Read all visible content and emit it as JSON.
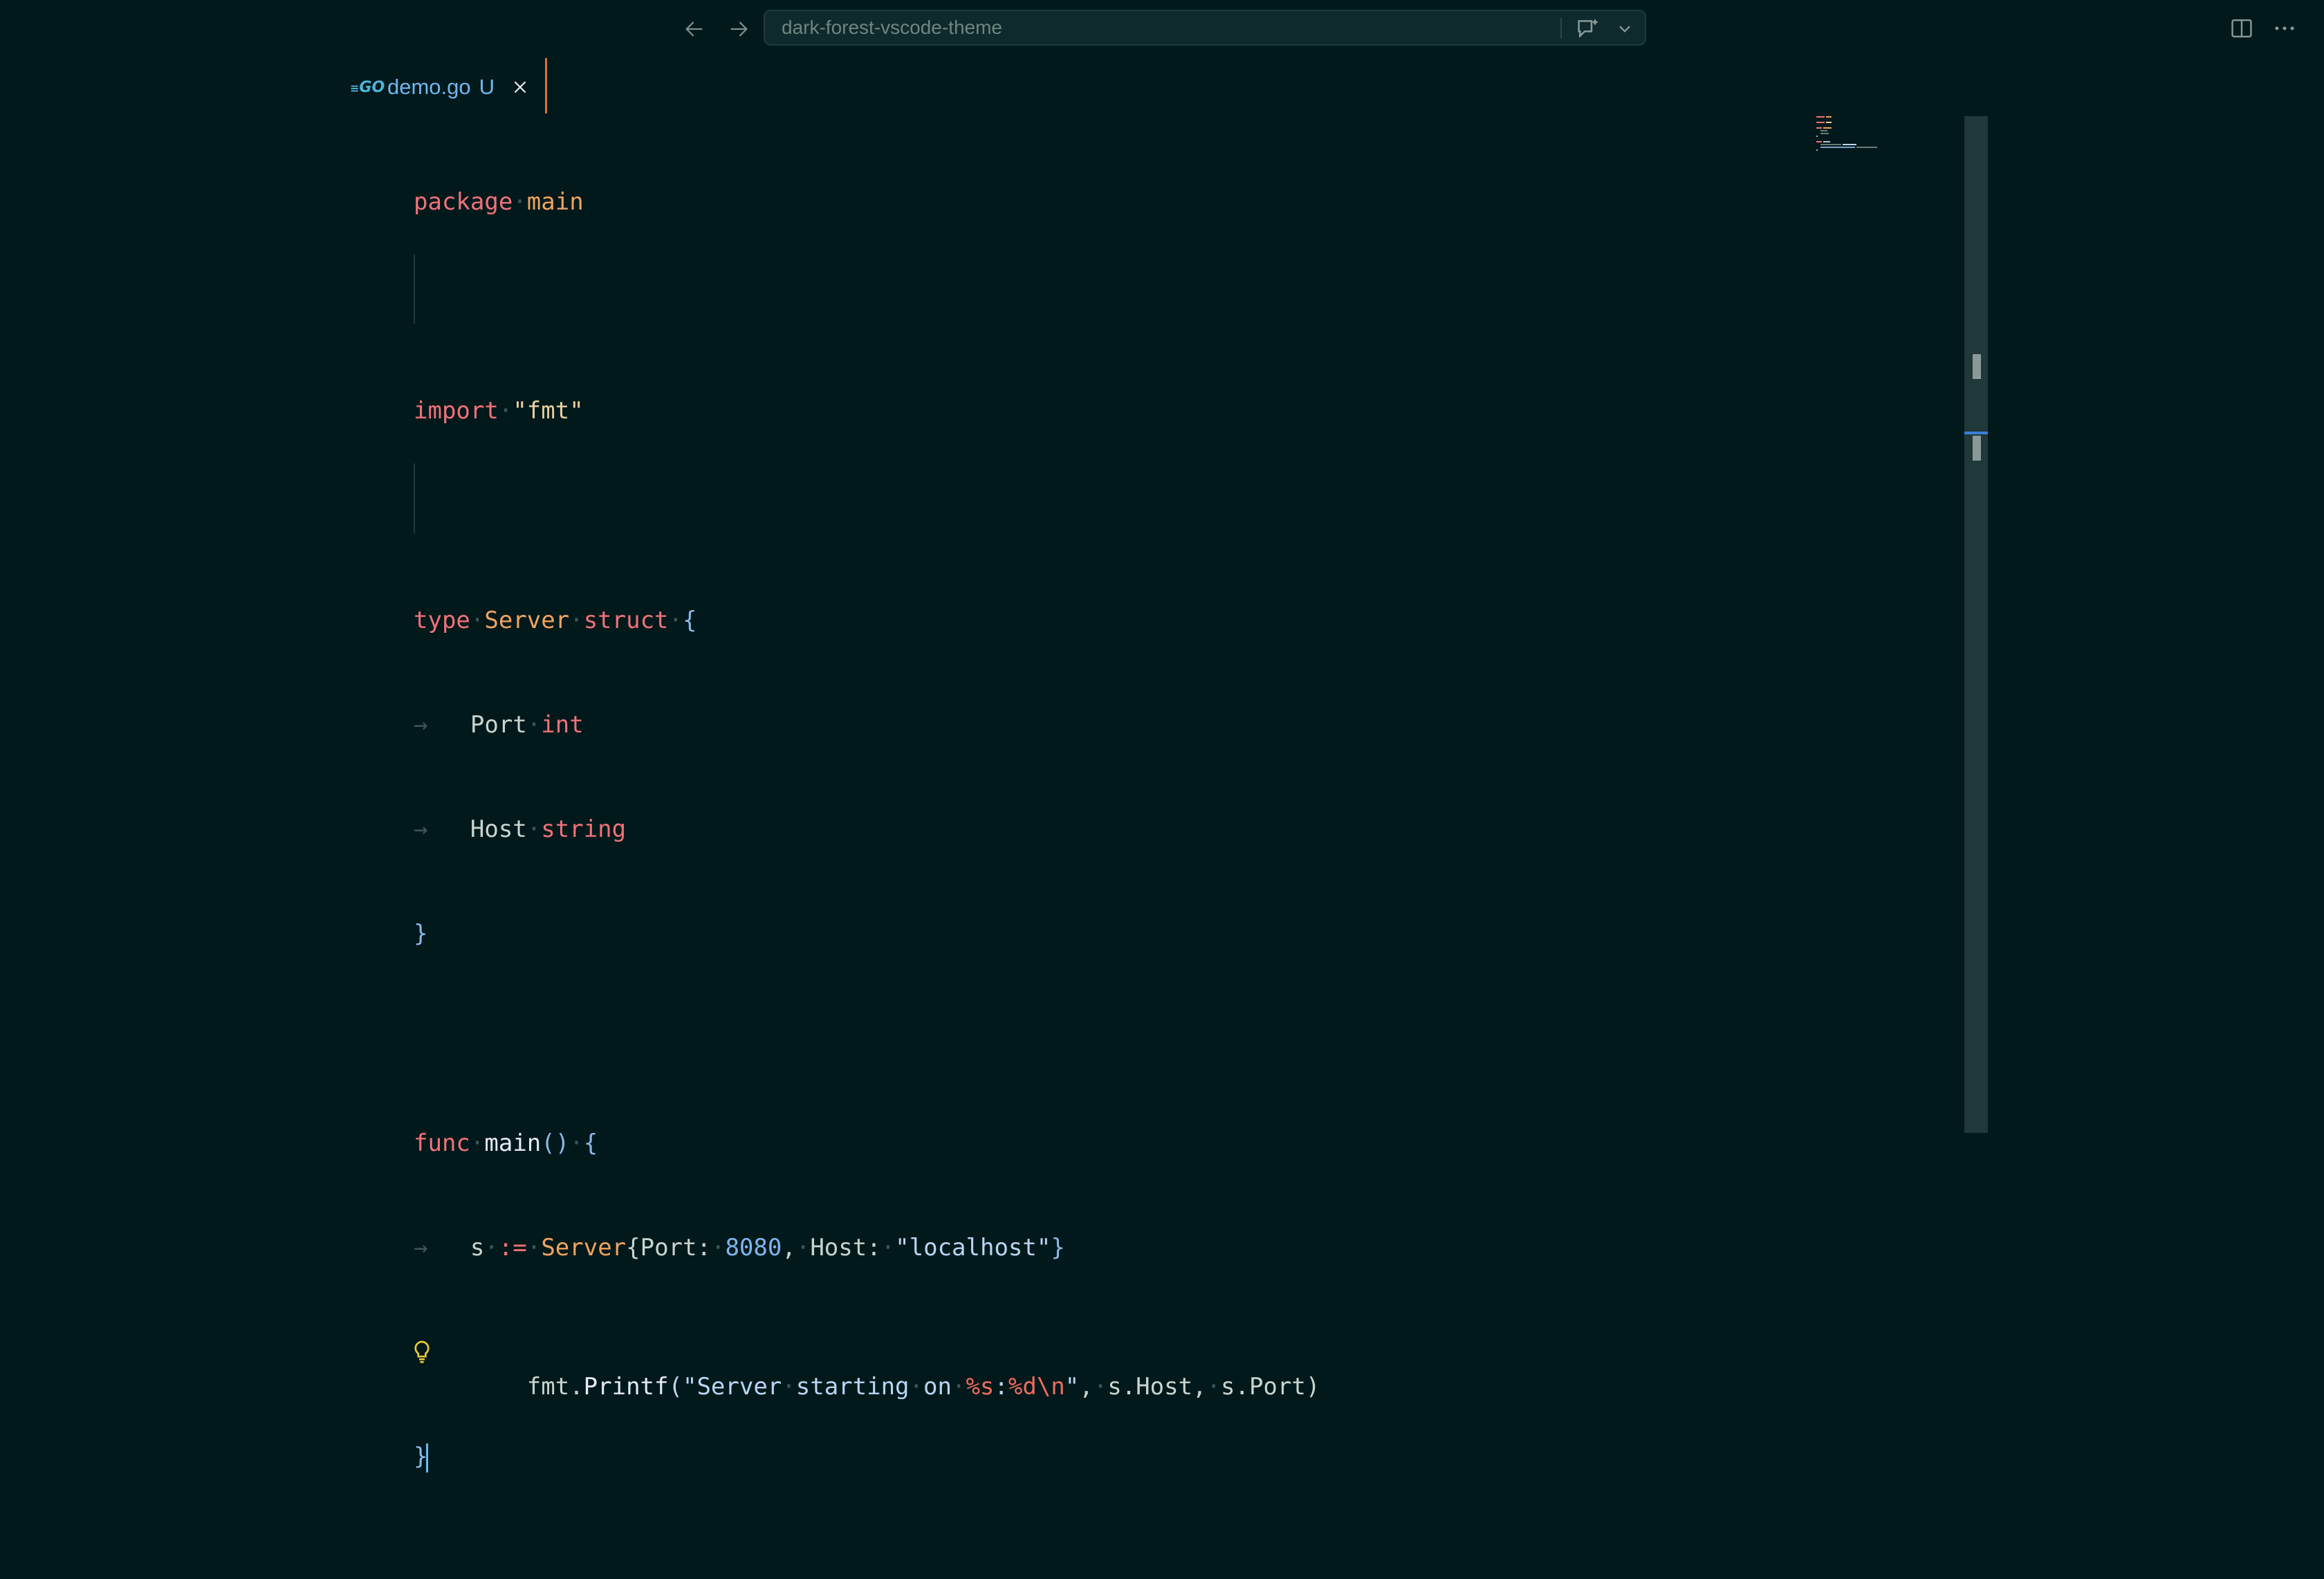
{
  "titlebar": {
    "search_text": "dark-forest-vscode-theme",
    "icons": [
      "arrow-left-icon",
      "arrow-right-icon",
      "chat-sparkle-icon",
      "chevron-down-icon",
      "split-editor-icon",
      "more-actions-icon"
    ]
  },
  "tab": {
    "icon_text": "GO",
    "filename": "demo.go",
    "status": "U"
  },
  "editor": {
    "language": "go",
    "code": {
      "l1": [
        "package",
        "·",
        "main"
      ],
      "l3": [
        "import",
        "·",
        "\"fmt\""
      ],
      "l5": [
        "type",
        "·",
        "Server",
        "·",
        "struct",
        "·",
        "{"
      ],
      "l6": [
        "→",
        "Port",
        "·",
        "int"
      ],
      "l7": [
        "→",
        "Host",
        "·",
        "string"
      ],
      "l8": [
        "}"
      ],
      "l10": [
        "func",
        "·",
        "main",
        "()",
        "·",
        "{"
      ],
      "l11": [
        "→",
        "s",
        "·",
        ":=",
        "·",
        "Server",
        "{Port:",
        "·",
        "8080",
        ",",
        "·",
        "Host:",
        "·",
        "\"localhost\"",
        "}"
      ],
      "l12": [
        "fmt.",
        "Printf",
        "(\"Server",
        "·",
        "starting",
        "·",
        "on",
        "·",
        "%s",
        ":",
        "%d",
        "\\n",
        "\"",
        ",",
        "·",
        "s.Host,",
        "·",
        "s.Port)"
      ],
      "l13": [
        "}"
      ]
    }
  },
  "colors": {
    "background": "#01191b",
    "keyword": "#f07178",
    "type": "#f0a35e",
    "string": "#ebcfa0",
    "number": "#7fb5ef",
    "accent_blue": "#6fb8f2",
    "tab_border": "#e06c3c"
  }
}
